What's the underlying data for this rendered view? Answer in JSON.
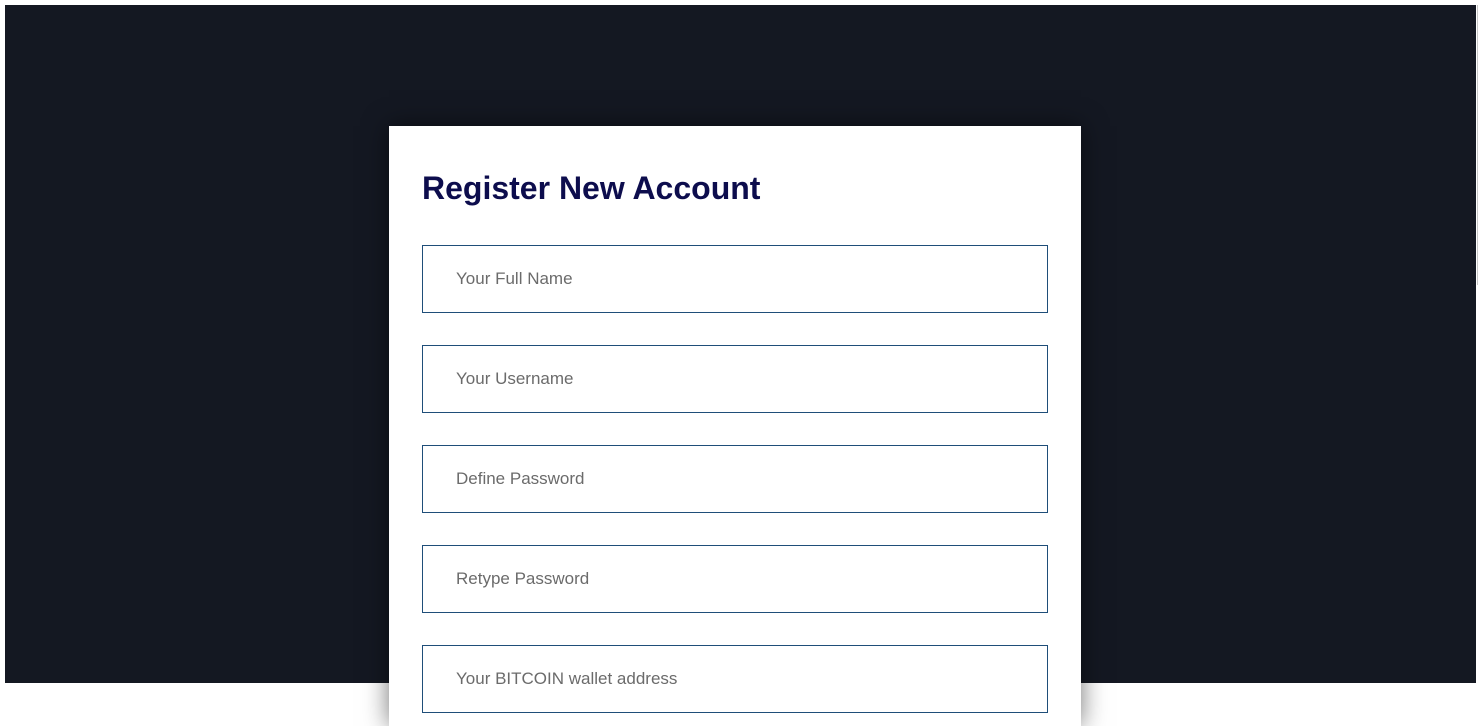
{
  "form": {
    "title": "Register New Account",
    "fields": [
      {
        "name": "full_name",
        "placeholder": "Your Full Name",
        "value": ""
      },
      {
        "name": "username",
        "placeholder": "Your Username",
        "value": ""
      },
      {
        "name": "password",
        "placeholder": "Define Password",
        "value": ""
      },
      {
        "name": "retype_password",
        "placeholder": "Retype Password",
        "value": ""
      },
      {
        "name": "bitcoin_wallet",
        "placeholder": "Your BITCOIN wallet address",
        "value": ""
      }
    ]
  },
  "colors": {
    "backdrop": "#141822",
    "title": "#0d0d4d",
    "field_border": "#1f4e79",
    "card": "#ffffff"
  }
}
